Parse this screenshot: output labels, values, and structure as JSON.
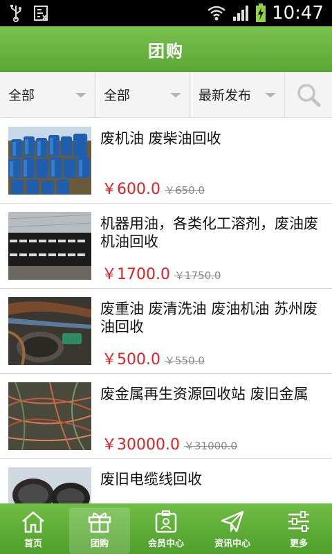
{
  "status_bar": {
    "time": "10:47",
    "icons": [
      "usb-icon",
      "debug-icon",
      "wifi-icon",
      "signal-icon",
      "battery-icon"
    ]
  },
  "header": {
    "title": "团购"
  },
  "filters": {
    "category": "全部",
    "area": "全部",
    "sort": "最新发布",
    "search_icon": "search-icon"
  },
  "items": [
    {
      "title": "废机油 废柴油回收",
      "price": "￥600.0",
      "old_price": "￥650.0"
    },
    {
      "title": "机器用油，各类化工溶剂，废油废机油回收",
      "price": "￥1700.0",
      "old_price": "￥1750.0"
    },
    {
      "title": "废重油 废清洗油 废油机油 苏州废油回收",
      "price": "￥500.0",
      "old_price": "￥550.0"
    },
    {
      "title": "废金属再生资源回收站 废旧金属",
      "price": "￥30000.0",
      "old_price": "￥31000.0"
    },
    {
      "title": "废旧电缆线回收",
      "price": "",
      "old_price": ""
    }
  ],
  "bottom_nav": [
    {
      "label": "首页",
      "icon": "home-icon",
      "active": false
    },
    {
      "label": "团购",
      "icon": "gift-icon",
      "active": true
    },
    {
      "label": "会员中心",
      "icon": "member-card-icon",
      "active": false
    },
    {
      "label": "资讯中心",
      "icon": "paper-plane-icon",
      "active": false
    },
    {
      "label": "更多",
      "icon": "sliders-icon",
      "active": false
    }
  ],
  "colors": {
    "accent_green": "#5aa634",
    "price_red": "#e02020"
  }
}
